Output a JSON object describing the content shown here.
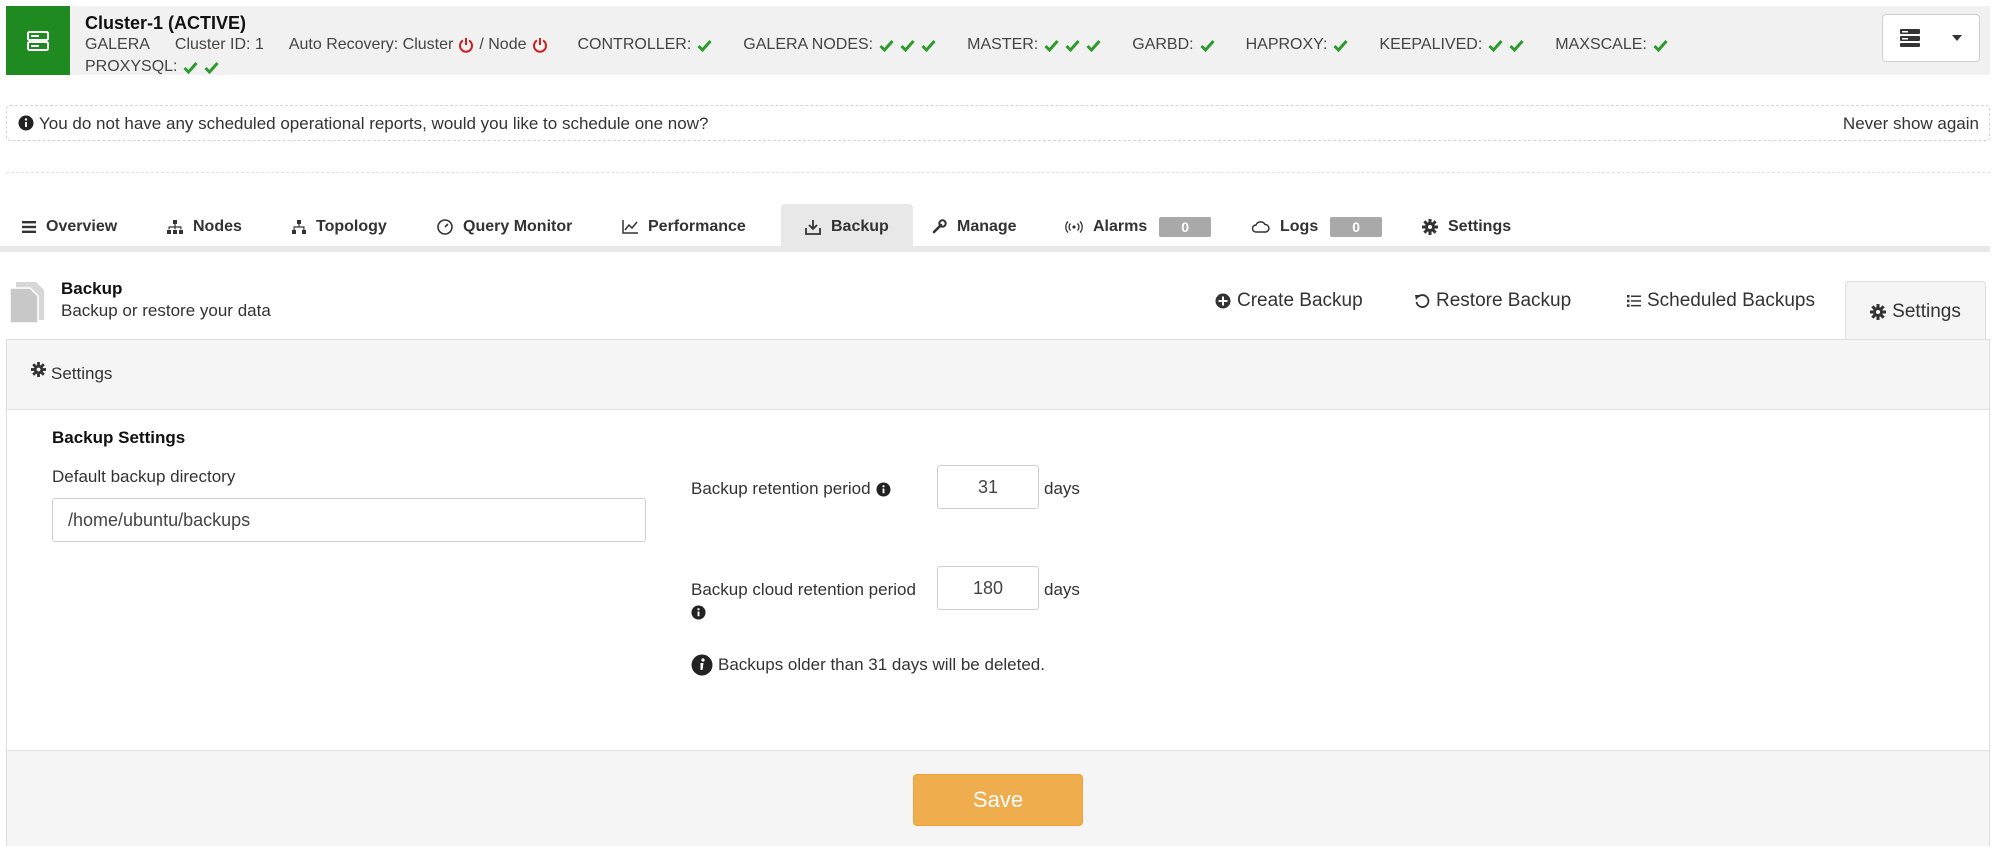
{
  "cluster": {
    "title": "Cluster-1 (ACTIVE)",
    "type": "GALERA",
    "id_label": "Cluster ID: 1",
    "auto_recovery_label": "Auto Recovery: Cluster",
    "node_label": "/ Node",
    "status_items": [
      {
        "label": "CONTROLLER:",
        "checks": 1
      },
      {
        "label": "GALERA NODES:",
        "checks": 3
      },
      {
        "label": "MASTER:",
        "checks": 3
      },
      {
        "label": "GARBD:",
        "checks": 1
      },
      {
        "label": "HAPROXY:",
        "checks": 1
      },
      {
        "label": "KEEPALIVED:",
        "checks": 2
      },
      {
        "label": "MAXSCALE:",
        "checks": 1
      }
    ],
    "proxysql_label": "PROXYSQL:",
    "proxysql_checks": 2,
    "ok_color": "#2e9a2e",
    "power_color": "#cc1f1f",
    "brand_color": "#1f8a1f"
  },
  "notice": {
    "text": "You do not have any scheduled operational reports, would you like to schedule one now?",
    "dismiss": "Never show again"
  },
  "main_tabs": [
    {
      "label": "Overview",
      "icon": "list-icon"
    },
    {
      "label": "Nodes",
      "icon": "sitemap-icon"
    },
    {
      "label": "Topology",
      "icon": "topology-icon"
    },
    {
      "label": "Query Monitor",
      "icon": "gauge-icon"
    },
    {
      "label": "Performance",
      "icon": "line-chart-icon"
    },
    {
      "label": "Backup",
      "icon": "download-icon",
      "active": true
    },
    {
      "label": "Manage",
      "icon": "wrench-icon"
    },
    {
      "label": "Alarms",
      "icon": "signal-icon",
      "badge": "0"
    },
    {
      "label": "Logs",
      "icon": "cloud-icon",
      "badge": "0"
    },
    {
      "label": "Settings",
      "icon": "gear-icon"
    }
  ],
  "backup": {
    "title": "Backup",
    "subtitle": "Backup or restore your data",
    "sub_tabs": {
      "create": "Create Backup",
      "restore": "Restore Backup",
      "scheduled": "Scheduled Backups",
      "settings": "Settings"
    }
  },
  "settings_panel": {
    "header": "Settings",
    "section_title": "Backup Settings",
    "directory_label": "Default backup directory",
    "directory_value": "/home/ubuntu/backups",
    "retention_label": "Backup retention period",
    "retention_value": "31",
    "retention_unit": "days",
    "cloud_retention_label": "Backup cloud retention period",
    "cloud_retention_value": "180",
    "cloud_retention_unit": "days",
    "hint": "Backups older than 31 days will be deleted.",
    "save_label": "Save",
    "save_color": "#f0ad4e"
  }
}
